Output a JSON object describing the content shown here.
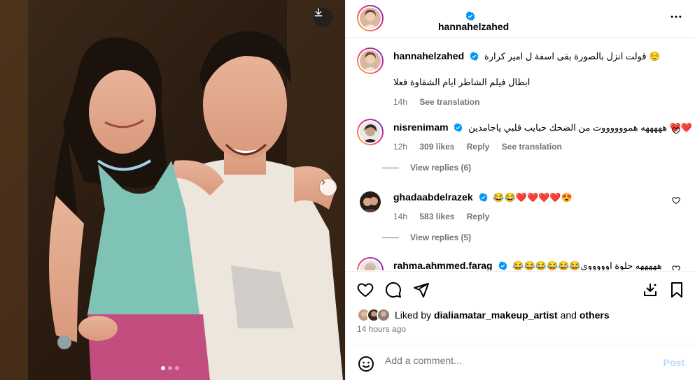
{
  "photo": {
    "download_icon": "download-icon",
    "next_icon": "chevron-right-icon",
    "carousel": {
      "count": 3,
      "active": 1
    }
  },
  "header": {
    "username": "hannahelzahed",
    "verified_icon": "verified-badge-icon",
    "more_icon": "more-horizontal-icon"
  },
  "caption": {
    "username": "hannahelzahed",
    "line1": "قولت انزل بالصورة بقى اسفة ل امير كرارة 😌",
    "line2": "ابطال فيلم الشاطر ايام الشقاوة فعلا",
    "time": "14h",
    "see_translation": "See translation"
  },
  "comments": [
    {
      "username": "nisrenimam",
      "text": "هههههه همووووووت من الضحك حبايب قلبي ياجامدين ❤️❤️",
      "time": "12h",
      "likes": "309 likes",
      "reply": "Reply",
      "see_translation": "See translation",
      "view_replies": "View replies (6)"
    },
    {
      "username": "ghadaabdelrazek",
      "text": "😂😂❤️❤️❤️❤️😍",
      "time": "14h",
      "likes": "583 likes",
      "reply": "Reply",
      "view_replies": "View replies (5)"
    },
    {
      "username": "rahma.ahmmed.farag",
      "text": "😂😂😂😂😂😂هههههه حلوة اوووووي"
    }
  ],
  "actions": {
    "like_icon": "heart-icon",
    "comment_icon": "comment-icon",
    "share_icon": "share-icon",
    "save_to_collection_icon": "download-collection-icon",
    "bookmark_icon": "bookmark-icon"
  },
  "likes": {
    "liked_by_prefix": "Liked by",
    "liked_by_user": "dialiamatar_makeup_artist",
    "and": "and",
    "others": "others",
    "time_ago": "14 hours ago"
  },
  "add_comment": {
    "placeholder": "Add a comment...",
    "post_label": "Post",
    "emoji_icon": "smiley-icon"
  },
  "colors": {
    "verified": "#0095f6",
    "muted": "#737373",
    "post_disabled": "#b3dbff",
    "heart_red": "#ff3040"
  }
}
